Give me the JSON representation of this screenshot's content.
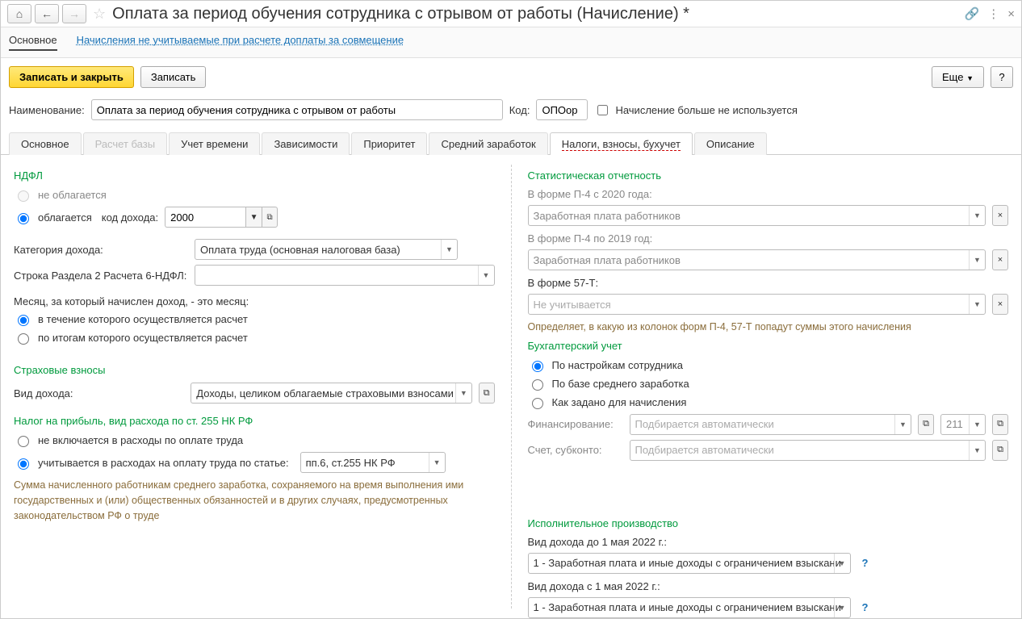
{
  "titlebar": {
    "title": "Оплата за период обучения сотрудника с отрывом от работы (Начисление) *"
  },
  "navbar": {
    "main": "Основное",
    "link": "Начисления не учитываемые при расчете доплаты за совмещение"
  },
  "toolbar": {
    "save_close": "Записать и закрыть",
    "save": "Записать",
    "more": "Еще",
    "help": "?"
  },
  "header": {
    "name_label": "Наименование:",
    "name_value": "Оплата за период обучения сотрудника с отрывом от работы",
    "code_label": "Код:",
    "code_value": "ОПОор",
    "not_used": "Начисление больше не используется"
  },
  "tabs": {
    "t0": "Основное",
    "t1": "Расчет базы",
    "t2": "Учет времени",
    "t3": "Зависимости",
    "t4": "Приоритет",
    "t5": "Средний заработок",
    "t6": "Налоги, взносы, бухучет",
    "t7": "Описание"
  },
  "left": {
    "ndfl_title": "НДФЛ",
    "ndfl_not": "не облагается",
    "ndfl_yes": "облагается",
    "income_code_label": "код дохода:",
    "income_code_value": "2000",
    "income_cat_label": "Категория дохода:",
    "income_cat_value": "Оплата труда (основная налоговая база)",
    "section2_label": "Строка Раздела 2 Расчета 6-НДФЛ:",
    "section2_value": "",
    "month_label": "Месяц, за который начислен доход, - это месяц:",
    "month_r1": "в течение которого осуществляется расчет",
    "month_r2": "по итогам которого осуществляется расчет",
    "strah_title": "Страховые взносы",
    "vid_dohoda_label": "Вид дохода:",
    "vid_dohoda_value": "Доходы, целиком облагаемые страховыми взносами",
    "nalog_title": "Налог на прибыль, вид расхода по ст. 255 НК РФ",
    "np_r1": "не включается в расходы по оплате труда",
    "np_r2": "учитывается в расходах на оплату труда по статье:",
    "np_value": "пп.6, ст.255 НК РФ",
    "hint": "Сумма начисленного работникам среднего заработка, сохраняемого на время выполнения ими государственных и (или) общественных обязанностей и в других случаях, предусмотренных законодательством РФ о труде"
  },
  "right": {
    "stat_title": "Статистическая отчетность",
    "p4_2020": "В форме П-4 с 2020 года:",
    "p4_2020_value": "Заработная плата работников",
    "p4_2019": "В форме П-4 по 2019 год:",
    "p4_2019_value": "Заработная плата работников",
    "f57t": "В форме 57-Т:",
    "f57t_placeholder": "Не учитывается",
    "stat_hint": "Определяет, в какую из колонок форм П-4, 57-Т попадут суммы этого начисления",
    "buh_title": "Бухгалтерский учет",
    "buh_r1": "По настройкам сотрудника",
    "buh_r2": "По базе среднего заработка",
    "buh_r3": "Как задано для начисления",
    "fin_label": "Финансирование:",
    "fin_ph": "Подбирается автоматически",
    "acct_count_value": "211",
    "schet_label": "Счет, субконто:",
    "schet_ph": "Подбирается автоматически",
    "isp_title": "Исполнительное производство",
    "isp_before_label": "Вид дохода до 1 мая 2022 г.:",
    "isp_before_value": "1 - Заработная плата и иные доходы с ограничением взыскани",
    "isp_after_label": "Вид дохода с 1 мая 2022 г.:",
    "isp_after_value": "1 - Заработная плата и иные доходы с ограничением взыскани"
  },
  "glyphs": {
    "dropdown": "▼",
    "expand": "⧉",
    "close": "×",
    "left": "←",
    "right": "→",
    "home": "⌂",
    "link": "🔗",
    "dots": "⋮"
  }
}
